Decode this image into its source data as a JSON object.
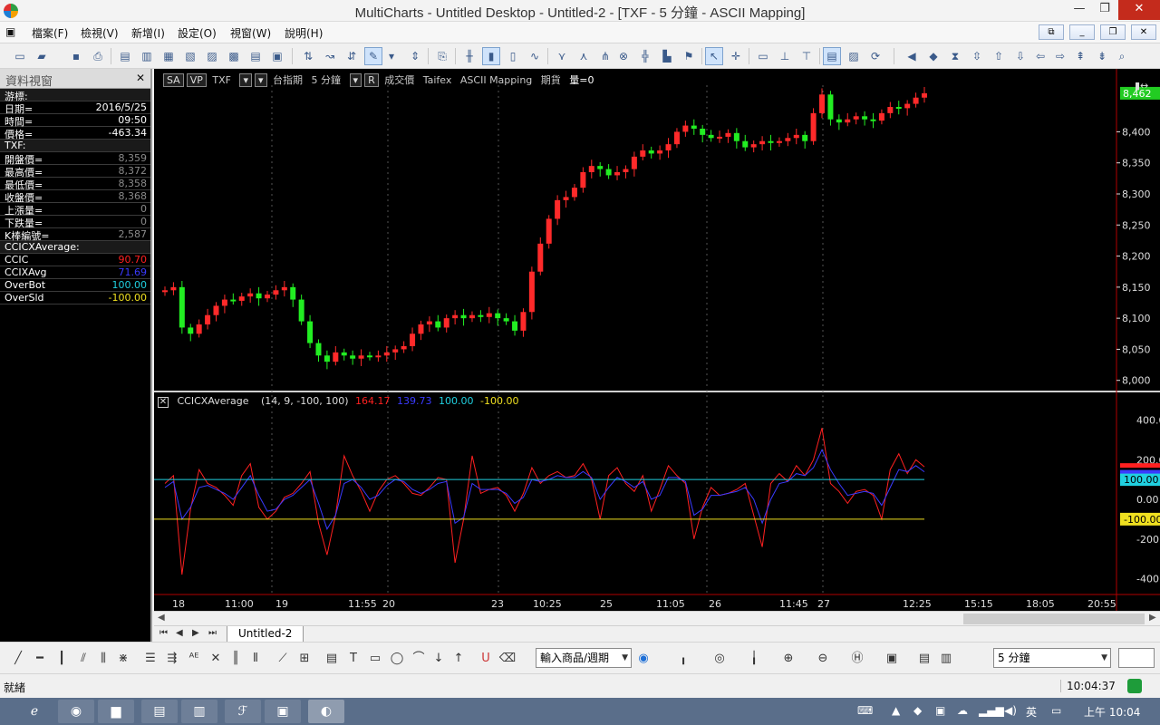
{
  "window": {
    "title": "MultiCharts - Untitled Desktop - Untitled-2 - [TXF - 5 分鐘 - ASCII Mapping]"
  },
  "menu": [
    "檔案(F)",
    "檢視(V)",
    "新增(I)",
    "設定(O)",
    "視窗(W)",
    "說明(H)"
  ],
  "data_panel": {
    "title": "資料視窗",
    "cursor_group": "游標:",
    "cursor_rows": [
      {
        "k": "日期=",
        "v": "2016/5/25"
      },
      {
        "k": "時間=",
        "v": "09:50"
      },
      {
        "k": "價格=",
        "v": "-463.34"
      }
    ],
    "symbol_group": "TXF:",
    "symbol_rows": [
      {
        "k": "開盤價=",
        "v": "8,359"
      },
      {
        "k": "最高價=",
        "v": "8,372"
      },
      {
        "k": "最低價=",
        "v": "8,358"
      },
      {
        "k": "收盤價=",
        "v": "8,368"
      },
      {
        "k": "上漲量=",
        "v": "0"
      },
      {
        "k": "下跌量=",
        "v": "0"
      },
      {
        "k": "K棒編號=",
        "v": "2,587"
      }
    ],
    "indicator_group": "CCICXAverage:",
    "indicator_rows": [
      {
        "k": "CCIC",
        "v": "90.70",
        "color": "#ff2020"
      },
      {
        "k": "CCIXAvg",
        "v": "71.69",
        "color": "#3a3aff"
      },
      {
        "k": "OverBot",
        "v": "100.00",
        "color": "#20d0e0"
      },
      {
        "k": "OverSld",
        "v": "-100.00",
        "color": "#f0e020"
      }
    ]
  },
  "chart_header": {
    "sa": "SA",
    "vp": "VP",
    "symbol": "TXF",
    "desc": "台指期",
    "interval": "5 分鐘",
    "r": "R",
    "trade": "成交價",
    "exchange": "Taifex",
    "mapping": "ASCII Mapping",
    "category": "期貨",
    "volume": "量=0"
  },
  "indicator_header": {
    "name": "CCICXAverage",
    "params": "(14, 9, -100, 100)",
    "v1": "164.17",
    "v1_color": "#ff2020",
    "v2": "139.73",
    "v2_color": "#3a3aff",
    "v3": "100.00",
    "v3_color": "#20d0e0",
    "v4": "-100.00",
    "v4_color": "#f0e020"
  },
  "chart_data": [
    {
      "type": "candlestick",
      "series_name": "TXF",
      "ylim": [
        7985,
        8475
      ],
      "y_ticks": [
        "8,400",
        "8,350",
        "8,300",
        "8,250",
        "8,200",
        "8,150",
        "8,100",
        "8,050",
        "8,000"
      ],
      "last_price_label": "8,462",
      "x_tick_labels": [
        "18",
        "11:00",
        "19",
        "11:55",
        "20",
        "23",
        "10:25",
        "25",
        "11:05",
        "26",
        "11:45",
        "27",
        "12:25",
        "15:15",
        "18:05",
        "20:55"
      ],
      "up_color": "#ff2a2a",
      "down_color": "#22ee22",
      "closes_approx": [
        8145,
        8150,
        8085,
        8075,
        8090,
        8105,
        8120,
        8130,
        8128,
        8135,
        8140,
        8132,
        8138,
        8145,
        8150,
        8130,
        8095,
        8060,
        8040,
        8030,
        8045,
        8040,
        8035,
        8040,
        8038,
        8040,
        8045,
        8050,
        8055,
        8075,
        8090,
        8095,
        8085,
        8100,
        8105,
        8100,
        8105,
        8102,
        8108,
        8100,
        8095,
        8080,
        8110,
        8175,
        8220,
        8260,
        8290,
        8295,
        8310,
        8335,
        8345,
        8340,
        8330,
        8335,
        8340,
        8360,
        8370,
        8365,
        8370,
        8380,
        8400,
        8410,
        8405,
        8395,
        8390,
        8392,
        8398,
        8385,
        8375,
        8380,
        8385,
        8382,
        8385,
        8390,
        8395,
        8385,
        8430,
        8460,
        8420,
        8415,
        8420,
        8425,
        8420,
        8418,
        8430,
        8440,
        8438,
        8445,
        8455,
        8462
      ]
    },
    {
      "type": "line",
      "series": [
        {
          "name": "CCIC",
          "color": "#ff2020",
          "values": [
            80,
            120,
            -380,
            -50,
            150,
            80,
            60,
            20,
            -30,
            120,
            180,
            -40,
            -100,
            -60,
            10,
            30,
            80,
            140,
            -120,
            -280,
            -80,
            220,
            120,
            40,
            -60,
            40,
            100,
            120,
            80,
            30,
            20,
            60,
            110,
            100,
            -320,
            -100,
            220,
            30,
            50,
            60,
            20,
            -60,
            30,
            160,
            80,
            120,
            140,
            110,
            120,
            180,
            100,
            -100,
            120,
            160,
            80,
            40,
            120,
            -60,
            50,
            170,
            120,
            80,
            -200,
            -40,
            60,
            20,
            30,
            50,
            80,
            -80,
            -240,
            80,
            130,
            90,
            170,
            120,
            200,
            360,
            80,
            40,
            -20,
            40,
            50,
            20,
            -100,
            150,
            230,
            130,
            200,
            164
          ]
        },
        {
          "name": "CCIXAvg",
          "color": "#3a3aff",
          "values": [
            60,
            90,
            -100,
            -40,
            60,
            70,
            50,
            30,
            0,
            60,
            120,
            20,
            -60,
            -50,
            0,
            20,
            60,
            100,
            -20,
            -150,
            -80,
            80,
            100,
            60,
            0,
            20,
            70,
            100,
            90,
            50,
            30,
            50,
            80,
            90,
            -120,
            -90,
            80,
            50,
            50,
            50,
            30,
            -20,
            10,
            100,
            90,
            100,
            120,
            110,
            110,
            140,
            110,
            0,
            60,
            110,
            90,
            60,
            90,
            0,
            20,
            110,
            110,
            90,
            -80,
            -50,
            20,
            20,
            30,
            40,
            60,
            0,
            -120,
            0,
            80,
            90,
            130,
            120,
            160,
            250,
            150,
            80,
            20,
            30,
            40,
            30,
            -30,
            60,
            150,
            140,
            170,
            139
          ]
        },
        {
          "name": "OverBot",
          "color": "#20d0e0",
          "constant": 100
        },
        {
          "name": "OverSld",
          "color": "#f0e020",
          "constant": -100
        }
      ],
      "ylim": [
        -480,
        480
      ],
      "y_ticks": [
        "400.00",
        "200.00",
        "0.00",
        "-200.00",
        "-400.00"
      ],
      "right_labels": [
        "100.00",
        "-100.00"
      ]
    }
  ],
  "tabs": {
    "active": "Untitled-2"
  },
  "drawbar": {
    "symbol_input": "輸入商品/週期",
    "interval_select": "5 分鐘"
  },
  "status": {
    "ready": "就緒",
    "clock": "10:04:37"
  },
  "taskbar": {
    "ime": "英",
    "time": "上午 10:04"
  }
}
